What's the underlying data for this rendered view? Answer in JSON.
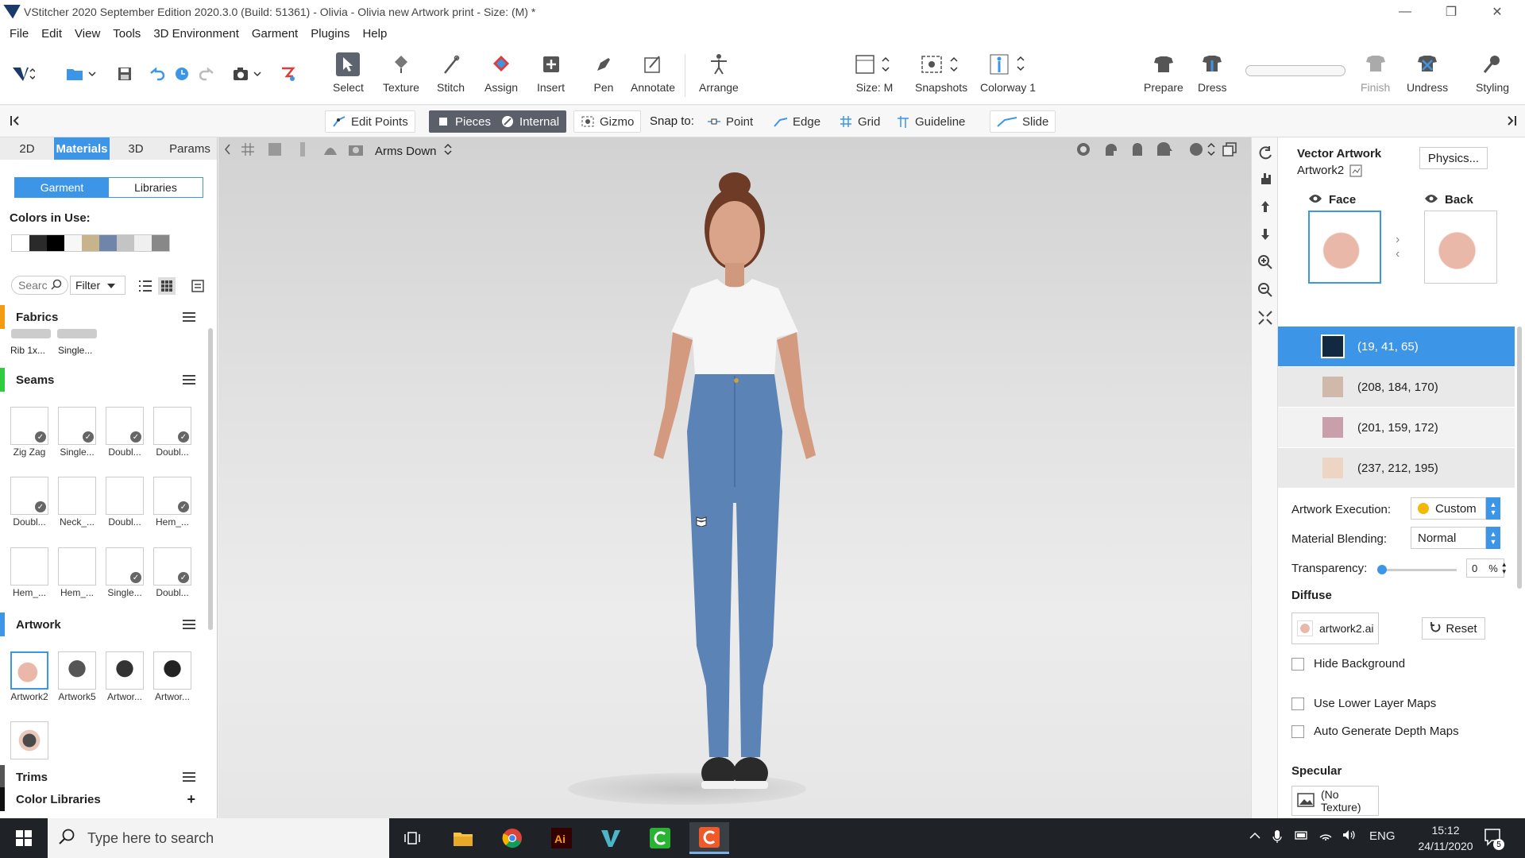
{
  "window": {
    "title": "VStitcher 2020 September Edition 2020.3.0 (Build: 51361) - Olivia - Olivia new Artwork print - Size: (M) *",
    "min_label": "—",
    "restore_label": "❐",
    "close_label": "✕"
  },
  "menu": [
    "File",
    "Edit",
    "View",
    "Tools",
    "3D Environment",
    "Garment",
    "Plugins",
    "Help"
  ],
  "toolbar": {
    "select": "Select",
    "texture": "Texture",
    "stitch": "Stitch",
    "assign": "Assign",
    "insert": "Insert",
    "pen": "Pen",
    "annotate": "Annotate",
    "arrange": "Arrange",
    "size": "Size: M",
    "snapshots": "Snapshots",
    "colorway": "Colorway 1",
    "prepare": "Prepare",
    "dress": "Dress",
    "finish": "Finish",
    "undress": "Undress",
    "styling": "Styling"
  },
  "subbar": {
    "edit_points": "Edit Points",
    "pieces": "Pieces",
    "internal": "Internal",
    "gizmo": "Gizmo",
    "snap_to": "Snap to:",
    "point": "Point",
    "edge": "Edge",
    "grid": "Grid",
    "guideline": "Guideline",
    "slide": "Slide"
  },
  "left_panel": {
    "tabs": [
      "2D",
      "Materials",
      "3D",
      "Params"
    ],
    "active_tab": "Materials",
    "segment": [
      "Garment",
      "Libraries"
    ],
    "colors_label": "Colors in Use:",
    "colors_in_use": [
      "#ffffff",
      "#2a2a2a",
      "#000000",
      "#f7f7f7",
      "#c7b48a",
      "#6f86aa",
      "#c4c4c4",
      "#efefef",
      "#888888"
    ],
    "search_placeholder": "Searc",
    "filter_label": "Filter",
    "categories": {
      "fabrics": "Fabrics",
      "seams": "Seams",
      "artwork": "Artwork",
      "trims": "Trims",
      "color_libraries": "Color Libraries"
    },
    "category_colors": {
      "fabrics": "#f39c12",
      "seams": "#2ecc40",
      "artwork": "#3d95e8",
      "trims": "#555555",
      "color_libraries": "#111111"
    },
    "fabric_items": [
      "Rib 1x...",
      "Single..."
    ],
    "seam_items": [
      "Zig Zag",
      "Single...",
      "Doubl...",
      "Doubl...",
      "Doubl...",
      "Neck_...",
      "Doubl...",
      "Hem_...",
      "Hem_...",
      "Hem_...",
      "Single...",
      "Doubl..."
    ],
    "artwork_items": [
      "Artwork2",
      "Artwork5",
      "Artwor...",
      "Artwor..."
    ],
    "color_libraries_add": "+"
  },
  "viewport": {
    "pose_label": "Arms Down"
  },
  "right_panel": {
    "title": "Vector Artwork",
    "subtitle": "Artwork2",
    "physics_button": "Physics...",
    "face_label": "Face",
    "back_label": "Back",
    "colors": [
      {
        "label": "(19, 41, 65)",
        "hex": "#132941",
        "selected": true
      },
      {
        "label": "(208, 184, 170)",
        "hex": "#d0b8aa",
        "selected": false
      },
      {
        "label": "(201, 159, 172)",
        "hex": "#c99fac",
        "selected": false
      },
      {
        "label": "(237, 212, 195)",
        "hex": "#edd4c3",
        "selected": false
      }
    ],
    "artwork_execution_label": "Artwork Execution:",
    "artwork_execution_value": "Custom",
    "material_blending_label": "Material Blending:",
    "material_blending_value": "Normal",
    "transparency_label": "Transparency:",
    "transparency_value": "0",
    "transparency_unit": "%",
    "diffuse_label": "Diffuse",
    "diffuse_file": "artwork2.ai",
    "reset_label": "Reset",
    "hide_background": "Hide Background",
    "use_lower_layer_maps": "Use Lower Layer Maps",
    "auto_generate_depth_maps": "Auto Generate Depth Maps",
    "specular_label": "Specular",
    "specular_texture": "(No Texture)"
  },
  "taskbar": {
    "search_placeholder": "Type here to search",
    "language": "ENG",
    "time": "15:12",
    "date": "24/11/2020",
    "notifications": "5"
  },
  "accent": "#3d95e8"
}
